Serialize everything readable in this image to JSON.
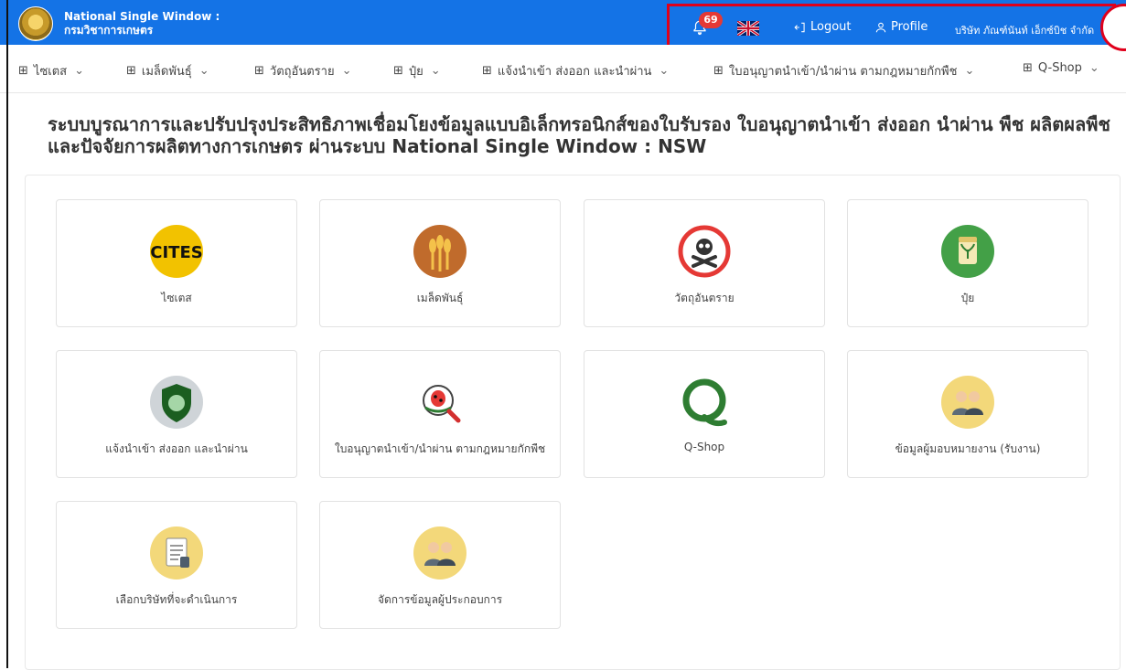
{
  "header": {
    "title": "National Single Window :",
    "subtitle": "กรมวิชาการเกษตร",
    "notifications_count": "69",
    "logout_label": "Logout",
    "profile_label": "Profile",
    "company_name": "บริษัท ภัณฑ์นันท์ เอ็กซ์บิช จำกัด"
  },
  "menu": {
    "items": [
      {
        "label": "ไซเตส"
      },
      {
        "label": "เมล็ดพันธุ์"
      },
      {
        "label": "วัตถุอันตราย"
      },
      {
        "label": "ปุ๋ย"
      },
      {
        "label": "แจ้งนำเข้า ส่งออก และนำผ่าน"
      },
      {
        "label": "ใบอนุญาตนำเข้า/นำผ่าน ตามกฎหมายกักพืช"
      },
      {
        "label": "Q-Shop"
      }
    ]
  },
  "page": {
    "title": "ระบบบูรณาการและปรับปรุงประสิทธิภาพเชื่อมโยงข้อมูลแบบอิเล็กทรอนิกส์ของใบรับรอง ใบอนุญาตนำเข้า ส่งออก นำผ่าน พืช ผลิตผลพืช และปัจจัยการผลิตทางการเกษตร ผ่านระบบ National Single Window : NSW"
  },
  "cards": [
    {
      "label": "ไซเตส",
      "icon": "cites-icon"
    },
    {
      "label": "เมล็ดพันธุ์",
      "icon": "seeds-icon"
    },
    {
      "label": "วัตถุอันตราย",
      "icon": "hazard-icon"
    },
    {
      "label": "ปุ๋ย",
      "icon": "fertilizer-icon"
    },
    {
      "label": "แจ้งนำเข้า ส่งออก และนำผ่าน",
      "icon": "dept-shield-icon"
    },
    {
      "label": "ใบอนุญาตนำเข้า/นำผ่าน ตามกฎหมายกักพืช",
      "icon": "plant-quarantine-icon"
    },
    {
      "label": "Q-Shop",
      "icon": "q-shop-icon"
    },
    {
      "label": "ข้อมูลผู้มอบหมายงาน (รับงาน)",
      "icon": "people-icon"
    },
    {
      "label": "เลือกบริษัทที่จะดำเนินการ",
      "icon": "document-icon"
    },
    {
      "label": "จัดการข้อมูลผู้ประกอบการ",
      "icon": "people-icon"
    }
  ],
  "colors": {
    "topbar": "#1473e6",
    "highlight": "#e0001b",
    "badge": "#e53935"
  }
}
